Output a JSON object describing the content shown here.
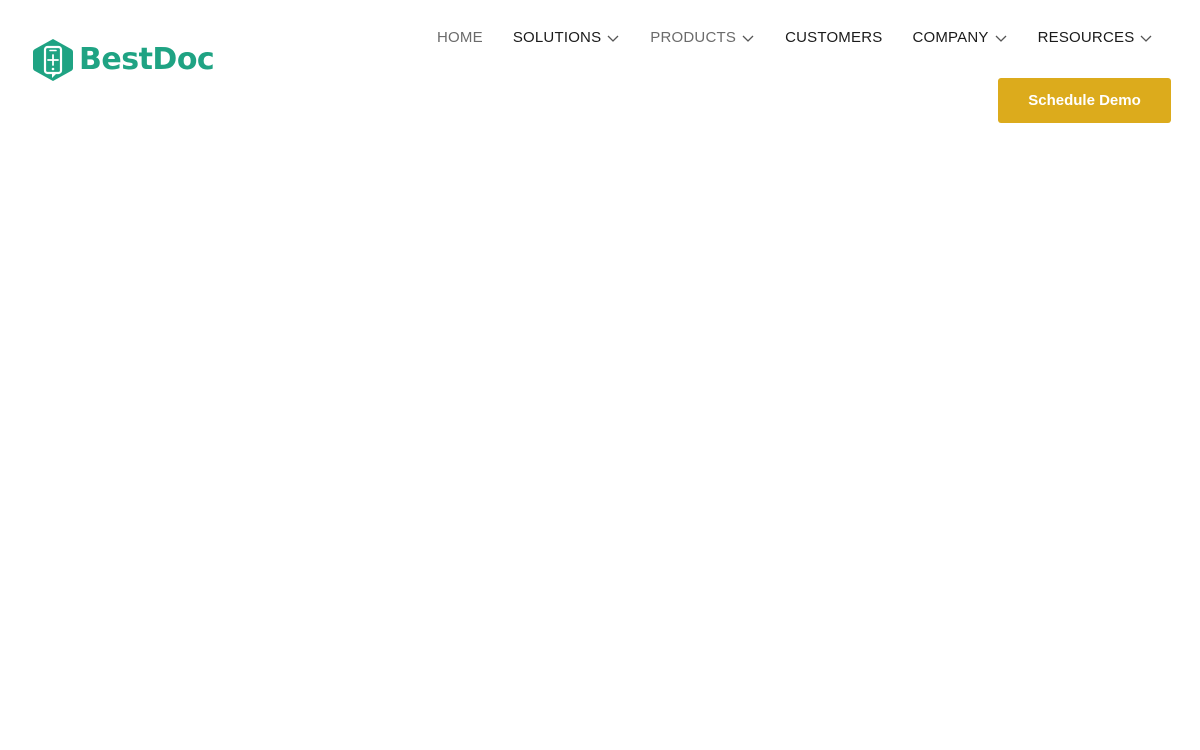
{
  "brand": {
    "name": "BestDoc",
    "logo_icon": "phone-hexagon-logo-icon",
    "color": "#1fa383"
  },
  "nav": {
    "items": [
      {
        "label": "HOME",
        "has_dropdown": false
      },
      {
        "label": "SOLUTIONS",
        "has_dropdown": true
      },
      {
        "label": "PRODUCTS",
        "has_dropdown": true
      },
      {
        "label": "CUSTOMERS",
        "has_dropdown": false
      },
      {
        "label": "COMPANY",
        "has_dropdown": true
      },
      {
        "label": "RESOURCES",
        "has_dropdown": true
      }
    ],
    "dropdown_icon": "chevron-down-icon"
  },
  "cta": {
    "label": "Schedule Demo",
    "color": "#dcab1c"
  }
}
